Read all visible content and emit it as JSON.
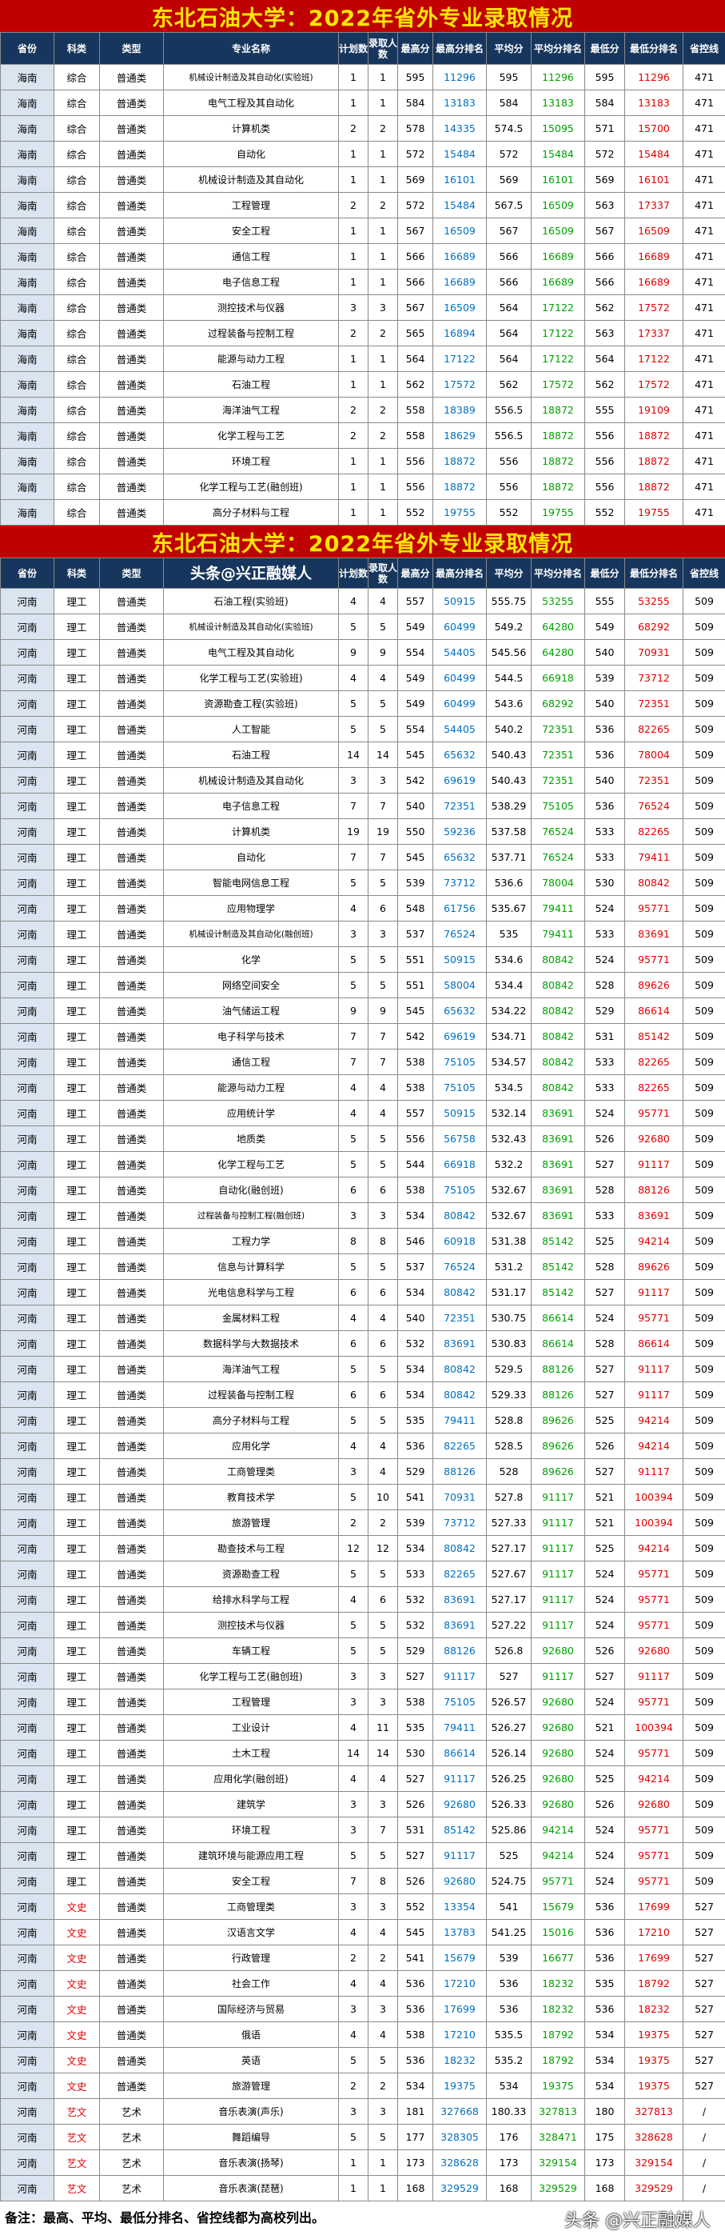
{
  "title1": "东北石油大学：2022年省外专业录取情况",
  "title2": "东北石油大学：2022年省外专业录取情况",
  "watermark_header": "头条@兴正融媒人",
  "headers": [
    "省份",
    "科类",
    "类型",
    "专业名称",
    "计划数",
    "录取人数",
    "最高分",
    "最高分排名",
    "平均分",
    "平均分排名",
    "最低分",
    "最低分排名",
    "省控线"
  ],
  "hainan_rows": [
    [
      "海南",
      "综合",
      "普通类",
      "机械设计制造及其自动化(实验班)",
      "1",
      "1",
      "595",
      "11296",
      "595",
      "11296",
      "595",
      "11296",
      "471"
    ],
    [
      "海南",
      "综合",
      "普通类",
      "电气工程及其自动化",
      "1",
      "1",
      "584",
      "13183",
      "584",
      "13183",
      "584",
      "13183",
      "471"
    ],
    [
      "海南",
      "综合",
      "普通类",
      "计算机类",
      "2",
      "2",
      "578",
      "14335",
      "574.5",
      "15095",
      "571",
      "15700",
      "471"
    ],
    [
      "海南",
      "综合",
      "普通类",
      "自动化",
      "1",
      "1",
      "572",
      "15484",
      "572",
      "15484",
      "572",
      "15484",
      "471"
    ],
    [
      "海南",
      "综合",
      "普通类",
      "机械设计制造及其自动化",
      "1",
      "1",
      "569",
      "16101",
      "569",
      "16101",
      "569",
      "16101",
      "471"
    ],
    [
      "海南",
      "综合",
      "普通类",
      "工程管理",
      "2",
      "2",
      "572",
      "15484",
      "567.5",
      "16509",
      "563",
      "17337",
      "471"
    ],
    [
      "海南",
      "综合",
      "普通类",
      "安全工程",
      "1",
      "1",
      "567",
      "16509",
      "567",
      "16509",
      "567",
      "16509",
      "471"
    ],
    [
      "海南",
      "综合",
      "普通类",
      "通信工程",
      "1",
      "1",
      "566",
      "16689",
      "566",
      "16689",
      "566",
      "16689",
      "471"
    ],
    [
      "海南",
      "综合",
      "普通类",
      "电子信息工程",
      "1",
      "1",
      "566",
      "16689",
      "566",
      "16689",
      "566",
      "16689",
      "471"
    ],
    [
      "海南",
      "综合",
      "普通类",
      "测控技术与仪器",
      "3",
      "3",
      "567",
      "16509",
      "564",
      "17122",
      "562",
      "17572",
      "471"
    ],
    [
      "海南",
      "综合",
      "普通类",
      "过程装备与控制工程",
      "2",
      "2",
      "565",
      "16894",
      "564",
      "17122",
      "563",
      "17337",
      "471"
    ],
    [
      "海南",
      "综合",
      "普通类",
      "能源与动力工程",
      "1",
      "1",
      "564",
      "17122",
      "564",
      "17122",
      "564",
      "17122",
      "471"
    ],
    [
      "海南",
      "综合",
      "普通类",
      "石油工程",
      "1",
      "1",
      "562",
      "17572",
      "562",
      "17572",
      "562",
      "17572",
      "471"
    ],
    [
      "海南",
      "综合",
      "普通类",
      "海洋油气工程",
      "2",
      "2",
      "558",
      "18389",
      "556.5",
      "18872",
      "555",
      "19109",
      "471"
    ],
    [
      "海南",
      "综合",
      "普通类",
      "化学工程与工艺",
      "2",
      "2",
      "558",
      "18629",
      "556.5",
      "18872",
      "556",
      "18872",
      "471"
    ],
    [
      "海南",
      "综合",
      "普通类",
      "环境工程",
      "1",
      "1",
      "556",
      "18872",
      "556",
      "18872",
      "556",
      "18872",
      "471"
    ],
    [
      "海南",
      "综合",
      "普通类",
      "化学工程与工艺(融创班)",
      "1",
      "1",
      "556",
      "18872",
      "556",
      "18872",
      "556",
      "18872",
      "471"
    ],
    [
      "海南",
      "综合",
      "普通类",
      "高分子材料与工程",
      "1",
      "1",
      "552",
      "19755",
      "552",
      "19755",
      "552",
      "19755",
      "471"
    ]
  ],
  "henan_rows": [
    [
      "河南",
      "理工",
      "普通类",
      "石油工程(实验班)",
      "4",
      "4",
      "557",
      "50915",
      "555.75",
      "53255",
      "555",
      "53255",
      "509"
    ],
    [
      "河南",
      "理工",
      "普通类",
      "机械设计制造及其自动化(实验班)",
      "5",
      "5",
      "549",
      "60499",
      "549.2",
      "64280",
      "549",
      "68292",
      "509"
    ],
    [
      "河南",
      "理工",
      "普通类",
      "电气工程及其自动化",
      "9",
      "9",
      "554",
      "54405",
      "545.56",
      "64280",
      "540",
      "70931",
      "509"
    ],
    [
      "河南",
      "理工",
      "普通类",
      "化学工程与工艺(实验班)",
      "4",
      "4",
      "549",
      "60499",
      "544.5",
      "66918",
      "539",
      "73712",
      "509"
    ],
    [
      "河南",
      "理工",
      "普通类",
      "资源勘查工程(实验班)",
      "5",
      "5",
      "549",
      "60499",
      "543.6",
      "68292",
      "540",
      "72351",
      "509"
    ],
    [
      "河南",
      "理工",
      "普通类",
      "人工智能",
      "5",
      "5",
      "554",
      "54405",
      "540.2",
      "72351",
      "536",
      "82265",
      "509"
    ],
    [
      "河南",
      "理工",
      "普通类",
      "石油工程",
      "14",
      "14",
      "545",
      "65632",
      "540.43",
      "72351",
      "536",
      "78004",
      "509"
    ],
    [
      "河南",
      "理工",
      "普通类",
      "机械设计制造及其自动化",
      "3",
      "3",
      "542",
      "69619",
      "540.43",
      "72351",
      "540",
      "72351",
      "509"
    ],
    [
      "河南",
      "理工",
      "普通类",
      "电子信息工程",
      "7",
      "7",
      "540",
      "72351",
      "538.29",
      "75105",
      "536",
      "76524",
      "509"
    ],
    [
      "河南",
      "理工",
      "普通类",
      "计算机类",
      "19",
      "19",
      "550",
      "59236",
      "537.58",
      "76524",
      "533",
      "82265",
      "509"
    ],
    [
      "河南",
      "理工",
      "普通类",
      "自动化",
      "7",
      "7",
      "545",
      "65632",
      "537.71",
      "76524",
      "533",
      "79411",
      "509"
    ],
    [
      "河南",
      "理工",
      "普通类",
      "智能电网信息工程",
      "5",
      "5",
      "539",
      "73712",
      "536.6",
      "78004",
      "530",
      "80842",
      "509"
    ],
    [
      "河南",
      "理工",
      "普通类",
      "应用物理学",
      "4",
      "6",
      "548",
      "61756",
      "535.67",
      "79411",
      "524",
      "95771",
      "509"
    ],
    [
      "河南",
      "理工",
      "普通类",
      "机械设计制造及其自动化(融创班)",
      "3",
      "3",
      "537",
      "76524",
      "535",
      "79411",
      "533",
      "83691",
      "509"
    ],
    [
      "河南",
      "理工",
      "普通类",
      "化学",
      "5",
      "5",
      "551",
      "50915",
      "534.6",
      "80842",
      "524",
      "95771",
      "509"
    ],
    [
      "河南",
      "理工",
      "普通类",
      "网络空间安全",
      "5",
      "5",
      "551",
      "58004",
      "534.4",
      "80842",
      "528",
      "89626",
      "509"
    ],
    [
      "河南",
      "理工",
      "普通类",
      "油气储运工程",
      "9",
      "9",
      "545",
      "65632",
      "534.22",
      "80842",
      "529",
      "86614",
      "509"
    ],
    [
      "河南",
      "理工",
      "普通类",
      "电子科学与技术",
      "7",
      "7",
      "542",
      "69619",
      "534.71",
      "80842",
      "531",
      "85142",
      "509"
    ],
    [
      "河南",
      "理工",
      "普通类",
      "通信工程",
      "7",
      "7",
      "538",
      "75105",
      "534.57",
      "80842",
      "533",
      "82265",
      "509"
    ],
    [
      "河南",
      "理工",
      "普通类",
      "能源与动力工程",
      "4",
      "4",
      "538",
      "75105",
      "534.5",
      "80842",
      "533",
      "82265",
      "509"
    ],
    [
      "河南",
      "理工",
      "普通类",
      "应用统计学",
      "4",
      "4",
      "557",
      "50915",
      "532.14",
      "83691",
      "524",
      "95771",
      "509"
    ],
    [
      "河南",
      "理工",
      "普通类",
      "地质类",
      "5",
      "5",
      "556",
      "56758",
      "532.43",
      "83691",
      "526",
      "92680",
      "509"
    ],
    [
      "河南",
      "理工",
      "普通类",
      "化学工程与工艺",
      "5",
      "5",
      "544",
      "66918",
      "532.2",
      "83691",
      "527",
      "91117",
      "509"
    ],
    [
      "河南",
      "理工",
      "普通类",
      "自动化(融创班)",
      "6",
      "6",
      "538",
      "75105",
      "532.67",
      "83691",
      "528",
      "88126",
      "509"
    ],
    [
      "河南",
      "理工",
      "普通类",
      "过程装备与控制工程(融创班)",
      "3",
      "3",
      "534",
      "80842",
      "532.67",
      "83691",
      "533",
      "83691",
      "509"
    ],
    [
      "河南",
      "理工",
      "普通类",
      "工程力学",
      "8",
      "8",
      "546",
      "60918",
      "531.38",
      "85142",
      "525",
      "94214",
      "509"
    ],
    [
      "河南",
      "理工",
      "普通类",
      "信息与计算科学",
      "5",
      "5",
      "537",
      "76524",
      "531.2",
      "85142",
      "528",
      "89626",
      "509"
    ],
    [
      "河南",
      "理工",
      "普通类",
      "光电信息科学与工程",
      "6",
      "6",
      "534",
      "80842",
      "531.17",
      "85142",
      "527",
      "91117",
      "509"
    ],
    [
      "河南",
      "理工",
      "普通类",
      "金属材料工程",
      "4",
      "4",
      "540",
      "72351",
      "530.75",
      "86614",
      "524",
      "95771",
      "509"
    ],
    [
      "河南",
      "理工",
      "普通类",
      "数据科学与大数据技术",
      "6",
      "6",
      "532",
      "83691",
      "530.83",
      "86614",
      "528",
      "86614",
      "509"
    ],
    [
      "河南",
      "理工",
      "普通类",
      "海洋油气工程",
      "5",
      "5",
      "534",
      "80842",
      "529.5",
      "88126",
      "527",
      "91117",
      "509"
    ],
    [
      "河南",
      "理工",
      "普通类",
      "过程装备与控制工程",
      "6",
      "6",
      "534",
      "80842",
      "529.33",
      "88126",
      "527",
      "91117",
      "509"
    ],
    [
      "河南",
      "理工",
      "普通类",
      "高分子材料与工程",
      "5",
      "5",
      "535",
      "79411",
      "528.8",
      "89626",
      "525",
      "94214",
      "509"
    ],
    [
      "河南",
      "理工",
      "普通类",
      "应用化学",
      "4",
      "4",
      "536",
      "82265",
      "528.5",
      "89626",
      "526",
      "94214",
      "509"
    ],
    [
      "河南",
      "理工",
      "普通类",
      "工商管理类",
      "3",
      "4",
      "529",
      "88126",
      "528",
      "89626",
      "527",
      "91117",
      "509"
    ],
    [
      "河南",
      "理工",
      "普通类",
      "教育技术学",
      "5",
      "10",
      "541",
      "70931",
      "527.8",
      "91117",
      "521",
      "100394",
      "509"
    ],
    [
      "河南",
      "理工",
      "普通类",
      "旅游管理",
      "2",
      "2",
      "539",
      "73712",
      "527.33",
      "91117",
      "521",
      "100394",
      "509"
    ],
    [
      "河南",
      "理工",
      "普通类",
      "勘查技术与工程",
      "12",
      "12",
      "534",
      "80842",
      "527.17",
      "91117",
      "525",
      "94214",
      "509"
    ],
    [
      "河南",
      "理工",
      "普通类",
      "资源勘查工程",
      "5",
      "5",
      "533",
      "82265",
      "527.67",
      "91117",
      "524",
      "95771",
      "509"
    ],
    [
      "河南",
      "理工",
      "普通类",
      "给排水科学与工程",
      "4",
      "6",
      "532",
      "83691",
      "527.17",
      "91117",
      "524",
      "95771",
      "509"
    ],
    [
      "河南",
      "理工",
      "普通类",
      "测控技术与仪器",
      "5",
      "5",
      "532",
      "83691",
      "527.22",
      "91117",
      "524",
      "95771",
      "509"
    ],
    [
      "河南",
      "理工",
      "普通类",
      "车辆工程",
      "5",
      "5",
      "529",
      "88126",
      "526.8",
      "92680",
      "526",
      "92680",
      "509"
    ],
    [
      "河南",
      "理工",
      "普通类",
      "化学工程与工艺(融创班)",
      "3",
      "3",
      "527",
      "91117",
      "527",
      "91117",
      "527",
      "91117",
      "509"
    ],
    [
      "河南",
      "理工",
      "普通类",
      "工程管理",
      "3",
      "3",
      "538",
      "75105",
      "526.57",
      "92680",
      "524",
      "95771",
      "509"
    ],
    [
      "河南",
      "理工",
      "普通类",
      "工业设计",
      "4",
      "11",
      "535",
      "79411",
      "526.27",
      "92680",
      "521",
      "100394",
      "509"
    ],
    [
      "河南",
      "理工",
      "普通类",
      "土木工程",
      "14",
      "14",
      "530",
      "86614",
      "526.14",
      "92680",
      "524",
      "95771",
      "509"
    ],
    [
      "河南",
      "理工",
      "普通类",
      "应用化学(融创班)",
      "4",
      "4",
      "527",
      "91117",
      "526.25",
      "92680",
      "525",
      "94214",
      "509"
    ],
    [
      "河南",
      "理工",
      "普通类",
      "建筑学",
      "3",
      "3",
      "526",
      "92680",
      "526.33",
      "92680",
      "526",
      "92680",
      "509"
    ],
    [
      "河南",
      "理工",
      "普通类",
      "环境工程",
      "3",
      "7",
      "531",
      "85142",
      "525.86",
      "94214",
      "524",
      "95771",
      "509"
    ],
    [
      "河南",
      "理工",
      "普通类",
      "建筑环境与能源应用工程",
      "5",
      "5",
      "527",
      "91117",
      "525",
      "94214",
      "524",
      "95771",
      "509"
    ],
    [
      "河南",
      "理工",
      "普通类",
      "安全工程",
      "7",
      "8",
      "526",
      "92680",
      "524.75",
      "95771",
      "524",
      "95771",
      "509"
    ],
    [
      "河南",
      "文史",
      "普通类",
      "工商管理类",
      "3",
      "3",
      "552",
      "13354",
      "541",
      "15679",
      "536",
      "17699",
      "527"
    ],
    [
      "河南",
      "文史",
      "普通类",
      "汉语言文学",
      "4",
      "4",
      "545",
      "13783",
      "541.25",
      "15016",
      "536",
      "17210",
      "527"
    ],
    [
      "河南",
      "文史",
      "普通类",
      "行政管理",
      "2",
      "2",
      "541",
      "15679",
      "539",
      "16677",
      "536",
      "17699",
      "527"
    ],
    [
      "河南",
      "文史",
      "普通类",
      "社会工作",
      "4",
      "4",
      "536",
      "17210",
      "536",
      "18232",
      "535",
      "18792",
      "527"
    ],
    [
      "河南",
      "文史",
      "普通类",
      "国际经济与贸易",
      "3",
      "3",
      "536",
      "17699",
      "536",
      "18232",
      "536",
      "18232",
      "527"
    ],
    [
      "河南",
      "文史",
      "普通类",
      "俄语",
      "4",
      "4",
      "538",
      "17210",
      "535.5",
      "18792",
      "534",
      "19375",
      "527"
    ],
    [
      "河南",
      "文史",
      "普通类",
      "英语",
      "5",
      "5",
      "536",
      "18232",
      "535.2",
      "18792",
      "534",
      "19375",
      "527"
    ],
    [
      "河南",
      "文史",
      "普通类",
      "旅游管理",
      "2",
      "2",
      "534",
      "19375",
      "534",
      "19375",
      "534",
      "19375",
      "527"
    ],
    [
      "河南",
      "艺文",
      "艺术",
      "音乐表演(声乐)",
      "3",
      "3",
      "181",
      "327668",
      "180.33",
      "327813",
      "180",
      "327813",
      "/"
    ],
    [
      "河南",
      "艺文",
      "艺术",
      "舞蹈编导",
      "5",
      "5",
      "177",
      "328305",
      "176",
      "328471",
      "175",
      "328628",
      "/"
    ],
    [
      "河南",
      "艺文",
      "艺术",
      "音乐表演(扬琴)",
      "1",
      "1",
      "173",
      "328628",
      "173",
      "329154",
      "173",
      "329154",
      "/"
    ],
    [
      "河南",
      "艺文",
      "艺术",
      "音乐表演(琵琶)",
      "1",
      "1",
      "168",
      "329529",
      "168",
      "329529",
      "168",
      "329529",
      "/"
    ]
  ],
  "footnote": "备注：最高、平均、最低分排名、省控线都为高校列出。",
  "watermark_footer": "头条 @兴正融媒人"
}
